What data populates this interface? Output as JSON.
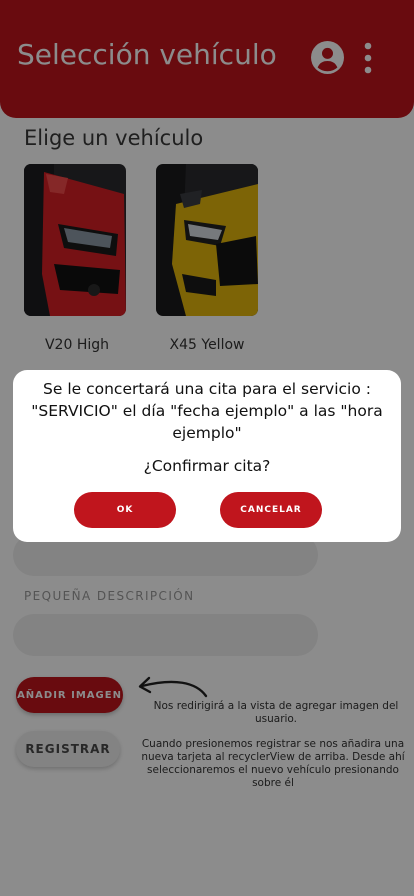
{
  "appbar": {
    "title": "Selección  vehículo",
    "account_icon": "account-circle-icon",
    "menu_icon": "more-vert-icon",
    "color": "#c0151d"
  },
  "main": {
    "section_title": "Elige un vehículo",
    "vehicles": [
      {
        "name": "V20 High",
        "image": "red-car-photo"
      },
      {
        "name": "X45 Yellow",
        "image": "yellow-car-photo"
      }
    ],
    "description_label": "PEQUEÑA DESCRIPCIÓN",
    "add_image_button": "AÑADIR IMAGEN",
    "register_button": "REGISTRAR",
    "note_add_image": "Nos redirigirá a la vista de agregar imagen del usuario.",
    "note_register": "Cuando presionemos registrar se nos añadira una nueva tarjeta al recyclerView de arriba. Desde ahí seleccionaremos el nuevo vehículo presionando sobre él"
  },
  "dialog": {
    "message": "Se le concertará una cita para el servicio : \"SERVICIO\" el día \"fecha ejemplo\" a las \"hora ejemplo\"",
    "question": "¿Confirmar cita?",
    "ok_label": "OK",
    "cancel_label": "CANCELAR"
  }
}
